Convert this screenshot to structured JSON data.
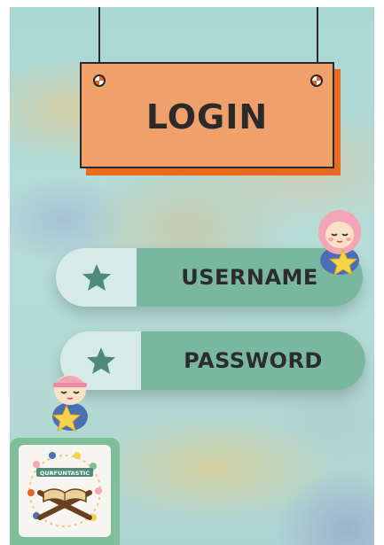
{
  "sign": {
    "title": "LOGIN",
    "colors": {
      "face": "#f0a06a",
      "shadow": "#e96b1f",
      "outline": "#2a2a2a"
    }
  },
  "fields": [
    {
      "id": "username",
      "label": "USERNAME",
      "icon": "star-icon"
    },
    {
      "id": "password",
      "label": "PASSWORD",
      "icon": "star-icon"
    }
  ],
  "colors": {
    "field_label_bg": "#79b7a0",
    "field_icon_bg": "#d6eae7",
    "star": "#4e8a77",
    "background": "#b3d9d2"
  },
  "logo": {
    "text": "QURFUNTASTIC",
    "icon": "quran-book-logo"
  },
  "decorations": [
    "girl-holding-star-icon",
    "boy-holding-star-icon"
  ]
}
